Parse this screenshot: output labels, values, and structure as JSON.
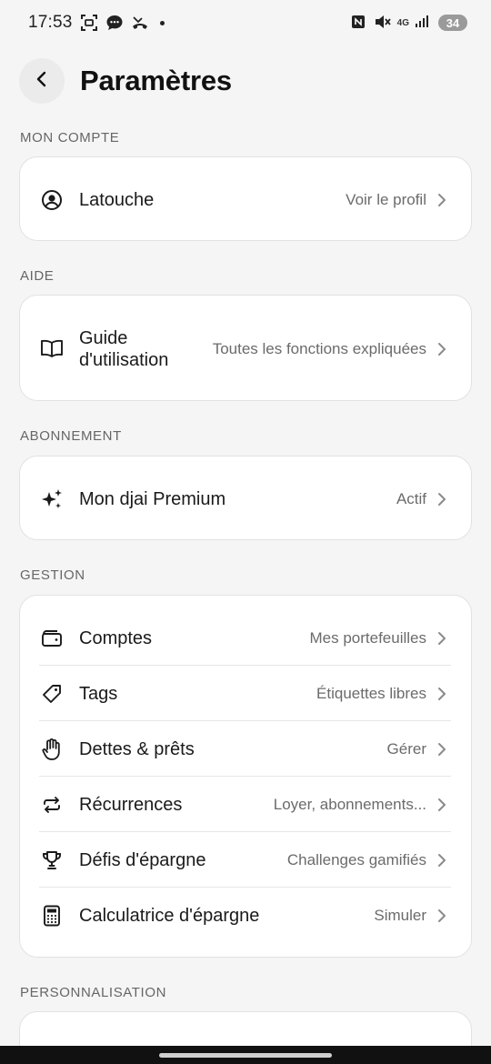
{
  "status_bar": {
    "time": "17:53",
    "network": "4G",
    "battery": "34",
    "icons": [
      "screenshot-icon",
      "messages-icon",
      "missed-call-icon",
      "notification-dot",
      "nfc-icon",
      "mute-icon",
      "signal-icon"
    ]
  },
  "header": {
    "back_icon": "chevron-left-icon",
    "title": "Paramètres"
  },
  "sections": {
    "account": {
      "label": "MON COMPTE",
      "items": [
        {
          "icon": "user-circle-icon",
          "label": "Latouche",
          "value": "Voir le profil"
        }
      ]
    },
    "help": {
      "label": "AIDE",
      "items": [
        {
          "icon": "book-icon",
          "label_line1": "Guide",
          "label_line2": "d'utilisation",
          "value": "Toutes les fonctions expliquées"
        }
      ]
    },
    "subscription": {
      "label": "ABONNEMENT",
      "items": [
        {
          "icon": "sparkles-icon",
          "label": "Mon djai Premium",
          "value": "Actif"
        }
      ]
    },
    "management": {
      "label": "GESTION",
      "items": [
        {
          "icon": "wallet-icon",
          "label": "Comptes",
          "value": "Mes portefeuilles"
        },
        {
          "icon": "tag-icon",
          "label": "Tags",
          "value": "Étiquettes libres"
        },
        {
          "icon": "hand-icon",
          "label": "Dettes & prêts",
          "value": "Gérer"
        },
        {
          "icon": "repeat-icon",
          "label": "Récurrences",
          "value": "Loyer, abonnements..."
        },
        {
          "icon": "trophy-icon",
          "label": "Défis d'épargne",
          "value": "Challenges gamifiés"
        },
        {
          "icon": "calculator-icon",
          "label": "Calculatrice d'épargne",
          "value": "Simuler"
        }
      ]
    },
    "personalization": {
      "label": "PERSONNALISATION"
    }
  },
  "colors": {
    "background": "#f5f5f5",
    "card": "#ffffff",
    "text_primary": "#1a1a1a",
    "text_secondary": "#6b6b6b"
  }
}
